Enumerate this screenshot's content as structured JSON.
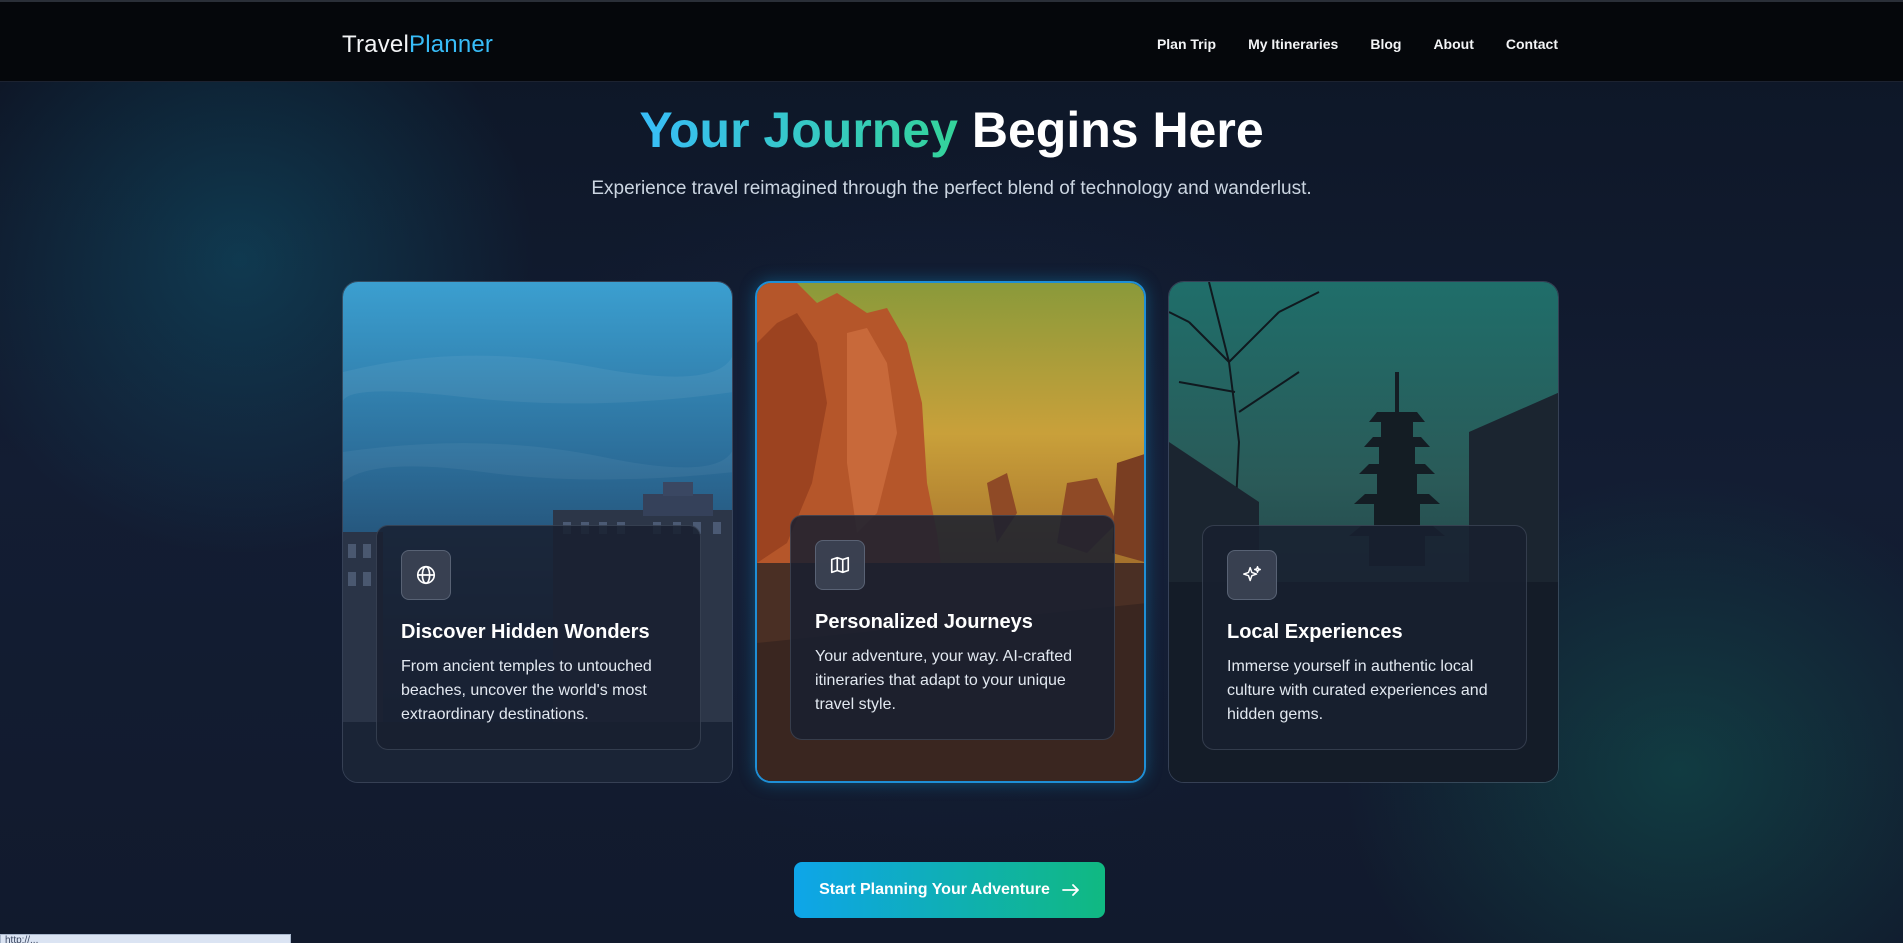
{
  "header": {
    "brand_part1": "Travel",
    "brand_part2": "Planner",
    "nav": [
      "Plan Trip",
      "My Itineraries",
      "Blog",
      "About",
      "Contact"
    ]
  },
  "hero": {
    "title_gradient": "Your Journey",
    "title_plain": "Begins Here",
    "subtitle": "Experience travel reimagined through the perfect blend of technology and wanderlust."
  },
  "cards": [
    {
      "icon": "globe-icon",
      "title": "Discover Hidden Wonders",
      "description": "From ancient temples to untouched beaches, uncover the world's most extraordinary destinations."
    },
    {
      "icon": "map-icon",
      "title": "Personalized Journeys",
      "description": "Your adventure, your way. AI-crafted itineraries that adapt to your unique travel style."
    },
    {
      "icon": "sparkles-icon",
      "title": "Local Experiences",
      "description": "Immerse yourself in authentic local culture with curated experiences and hidden gems."
    }
  ],
  "cta": {
    "label": "Start Planning Your Adventure",
    "icon": "arrow-right-icon"
  },
  "status_bar": {
    "url": "http://..."
  },
  "colors": {
    "accent_blue": "#38bdf8",
    "accent_green": "#34d399",
    "header_bg": "#05070b",
    "page_bg": "#0f1829"
  }
}
